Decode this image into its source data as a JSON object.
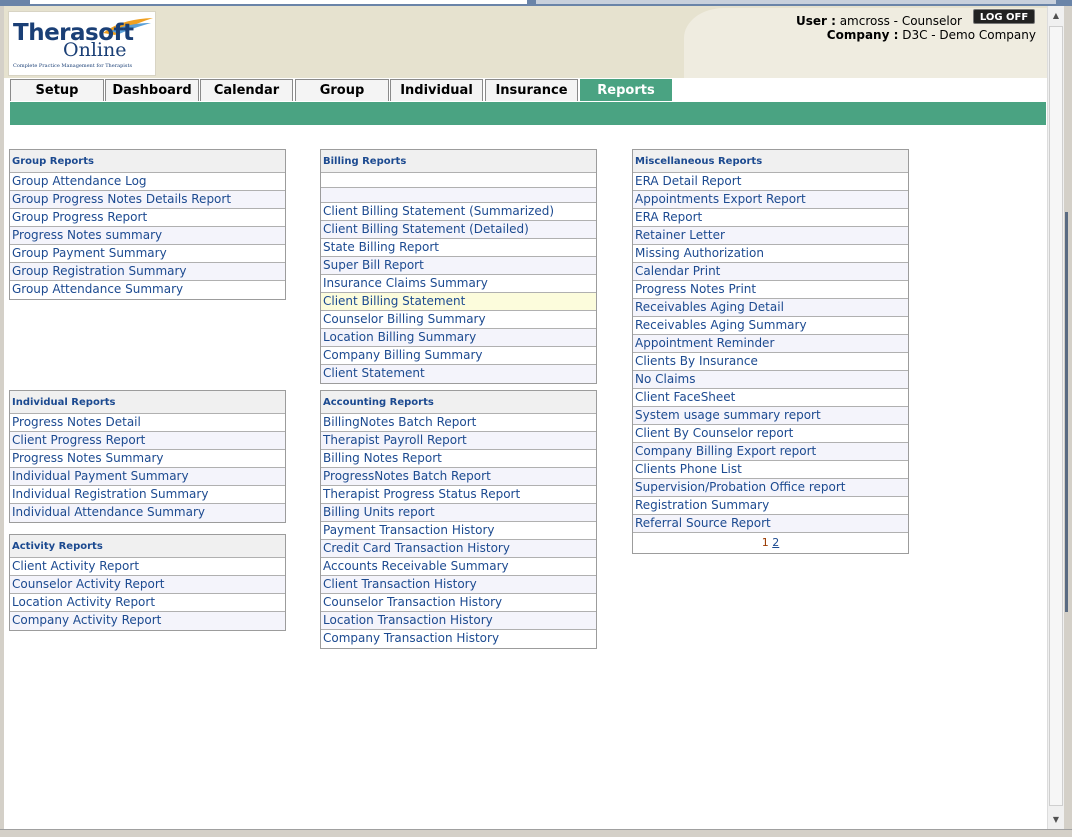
{
  "header": {
    "logo": {
      "name": "Therasoft",
      "online": "Online",
      "tagline": "Complete Practice Management for Therapists"
    },
    "user_label": "User :",
    "user_value": "amcross - Counselor",
    "company_label": "Company :",
    "company_value": "D3C - Demo Company",
    "logoff_label": "LOG OFF"
  },
  "tabs": [
    "Setup",
    "Dashboard",
    "Calendar",
    "Group",
    "Individual",
    "Insurance",
    "Reports"
  ],
  "active_tab": "Reports",
  "colors": {
    "accent": "#4aa382",
    "link": "#1c4a90",
    "highlight_row": "#fcfcdc"
  },
  "group_reports": {
    "title": "Group Reports",
    "items": [
      "Group Attendance Log",
      "Group Progress Notes Details Report",
      "Group Progress Report",
      "Progress Notes summary",
      "Group Payment Summary",
      "Group Registration Summary",
      "Group Attendance Summary"
    ]
  },
  "individual_reports": {
    "title": "Individual Reports",
    "items": [
      "Progress Notes Detail",
      "Client Progress Report",
      "Progress Notes Summary",
      "Individual Payment Summary",
      "Individual Registration Summary",
      "Individual Attendance Summary"
    ]
  },
  "activity_reports": {
    "title": "Activity Reports",
    "items": [
      "Client Activity Report",
      "Counselor Activity Report",
      "Location Activity Report",
      "Company Activity Report"
    ]
  },
  "billing_reports": {
    "title": "Billing Reports",
    "items": [
      "",
      "Client Billing Statement (Summarized)",
      "Client Billing Statement (Detailed)",
      "State Billing Report",
      "Super Bill Report",
      "Insurance Claims Summary",
      "Client Billing Statement",
      "Counselor Billing Summary",
      "Location Billing Summary",
      "Company Billing Summary",
      "Client Statement"
    ]
  },
  "accounting_reports": {
    "title": "Accounting Reports",
    "items": [
      "BillingNotes Batch Report",
      "Therapist Payroll Report",
      "Billing Notes Report",
      "ProgressNotes Batch Report",
      "Therapist Progress Status Report",
      "Billing Units report",
      "Payment Transaction History",
      "Credit Card Transaction History",
      "Accounts Receivable Summary",
      "Client Transaction History",
      "Counselor Transaction History",
      "Location Transaction History",
      "Company Transaction History"
    ]
  },
  "misc_reports": {
    "title": "Miscellaneous Reports",
    "items": [
      "ERA Detail Report",
      "Appointments Export Report",
      "ERA Report",
      "Retainer Letter",
      "Missing Authorization",
      "Calendar Print",
      "Progress Notes Print",
      "Receivables Aging Detail",
      "Receivables Aging Summary",
      "Appointment Reminder",
      "Clients By Insurance",
      "No Claims",
      "Client FaceSheet",
      "System usage summary report",
      "Client By Counselor report",
      "Company Billing Export report",
      "Clients Phone List",
      "Supervision/Probation Office report",
      "Registration Summary",
      "Referral Source Report"
    ],
    "pager": {
      "current": "1",
      "next": "2"
    }
  }
}
